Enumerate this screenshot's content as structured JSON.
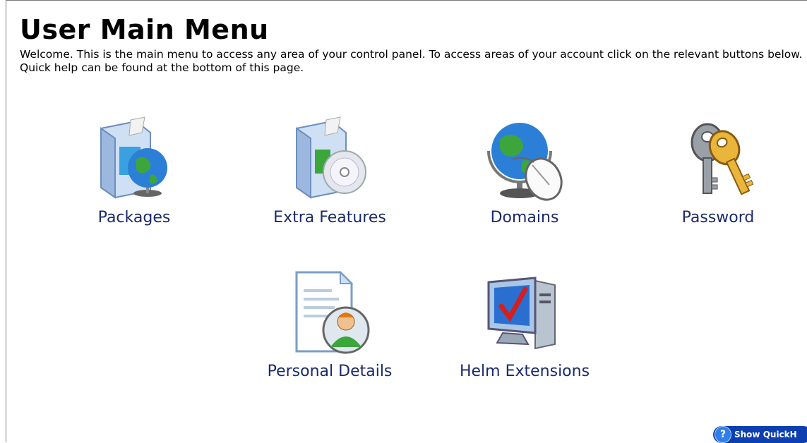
{
  "page": {
    "title": "User Main Menu",
    "intro": "Welcome. This is the main menu to access any area of your control panel. To access areas of your account click on the relevant buttons below. Quick help can be found at the bottom of this page."
  },
  "menu": {
    "items": [
      {
        "label": "Packages",
        "icon": "software-globe-icon"
      },
      {
        "label": "Extra Features",
        "icon": "software-cd-icon"
      },
      {
        "label": "Domains",
        "icon": "globe-mouse-icon"
      },
      {
        "label": "Password",
        "icon": "keys-icon"
      },
      {
        "label": "Personal Details",
        "icon": "user-document-icon"
      },
      {
        "label": "Helm Extensions",
        "icon": "computer-check-icon"
      }
    ]
  },
  "quickhelp": {
    "label": "Show QuickH",
    "icon": "question-icon"
  }
}
